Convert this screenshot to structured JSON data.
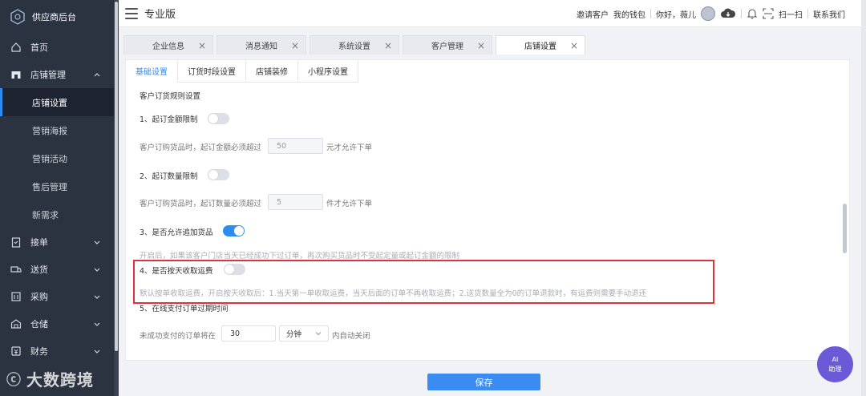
{
  "sidebar": {
    "brand": "供应商后台",
    "items": [
      {
        "label": "首页",
        "icon": "home-icon"
      },
      {
        "label": "店铺管理",
        "icon": "store-icon",
        "expanded": true
      },
      {
        "label": "接单",
        "icon": "clipboard-icon"
      },
      {
        "label": "送货",
        "icon": "truck-icon"
      },
      {
        "label": "采购",
        "icon": "cart-icon"
      },
      {
        "label": "仓储",
        "icon": "warehouse-icon"
      },
      {
        "label": "财务",
        "icon": "finance-icon"
      }
    ],
    "submenu": [
      "店铺设置",
      "营销海报",
      "营销活动",
      "售后管理",
      "新需求"
    ],
    "active_sub": "店铺设置"
  },
  "watermark": "大数跨境",
  "header": {
    "title": "专业版",
    "invite": "邀请客户",
    "wallet": "我的钱包",
    "greeting": "你好，薇儿",
    "scan": "扫一扫",
    "contact": "联系我们"
  },
  "page_tabs": [
    "企业信息",
    "消息通知",
    "系统设置",
    "客户管理",
    "店铺设置"
  ],
  "active_page_tab": "店铺设置",
  "sub_tabs": [
    "基础设置",
    "订货时段设置",
    "店铺装修",
    "小程序设置"
  ],
  "active_sub_tab": "基础设置",
  "settings": {
    "section_title": "客户订货规则设置",
    "rule1": {
      "title": "1、起订金额限制",
      "on": false,
      "desc_before": "客户订购货品时，起订金额必须超过",
      "value": "50",
      "desc_after": "元才允许下单"
    },
    "rule2": {
      "title": "2、起订数量限制",
      "on": false,
      "desc_before": "客户订购货品时，起订数量必须超过",
      "value": "5",
      "desc_after": "件才允许下单"
    },
    "rule3": {
      "title": "3、是否允许追加货品",
      "on": true,
      "desc": "开启后，如果该客户门店当天已经成功下过订单，再次购买货品时不受起定量或起订金额的限制"
    },
    "rule4": {
      "title": "4、是否按天收取运费",
      "on": false,
      "desc": "默认按单收取运费，开启按天收取后：1.当天第一单收取运费，当天后面的订单不再收取运费；2.送货数量全为0的订单退款时，有运费则需要手动退还"
    },
    "rule5": {
      "title": "5、在线支付订单过期时间",
      "desc_before": "未成功支付的订单将在",
      "value": "30",
      "unit": "分钟",
      "desc_after": "内自动关闭"
    }
  },
  "save_label": "保存",
  "ai_label_1": "AI",
  "ai_label_2": "助理"
}
